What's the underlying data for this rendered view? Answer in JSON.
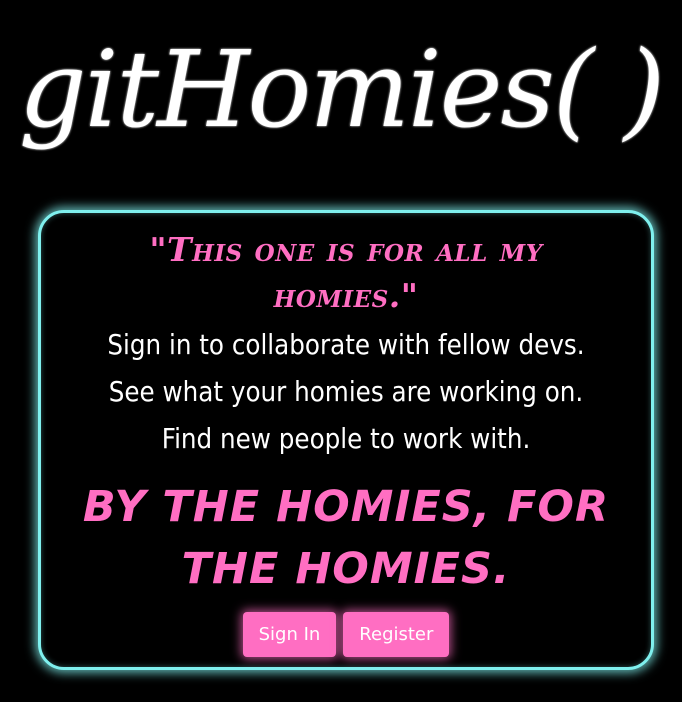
{
  "brand": {
    "logo_text": "gitHomies( )"
  },
  "card": {
    "quote": "\"This one is for all my homies.\"",
    "description_lines": [
      "Sign in to collaborate with fellow devs.",
      "See what your homies are working on.",
      "Find new people to work with."
    ],
    "tagline": "BY THE HOMIES, FOR THE HOMIES.",
    "buttons": {
      "sign_in": "Sign In",
      "register": "Register"
    }
  },
  "colors": {
    "background": "#000000",
    "accent_pink": "#ff6ec2",
    "glow_cyan": "#7ff0ee",
    "text": "#ffffff"
  }
}
